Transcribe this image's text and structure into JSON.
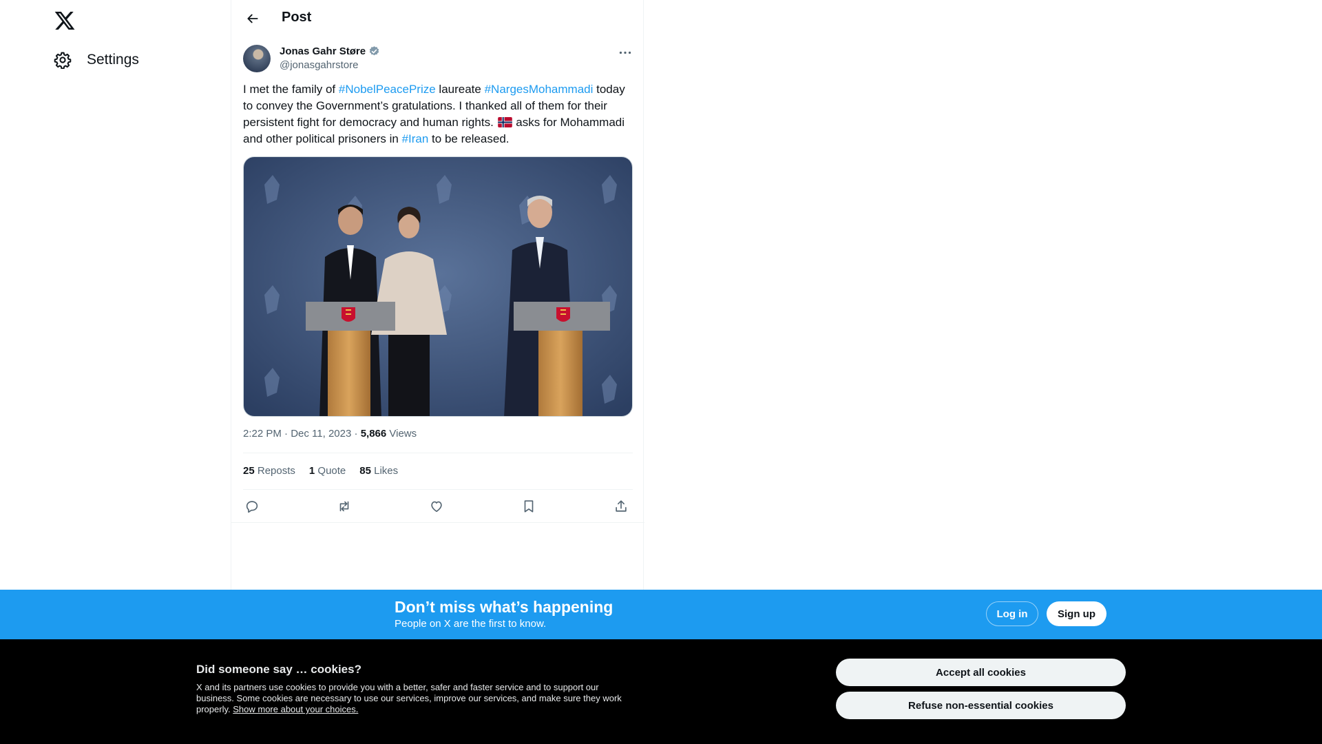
{
  "sidebar": {
    "logo_icon": "x-logo-icon",
    "settings_label": "Settings",
    "settings_icon": "gear-icon"
  },
  "header": {
    "title": "Post",
    "back_icon": "arrow-left-icon"
  },
  "post": {
    "author_name": "Jonas Gahr Støre",
    "author_handle": "@jonasgahrstore",
    "verified_icon": "verified-badge-icon",
    "more_icon": "more-dots-icon",
    "text": {
      "t1": "I met the family of ",
      "h1": "#NobelPeacePrize",
      "t2": " laureate ",
      "h2": "#NargesMohammadi",
      "t3": " today to convey the Government’s gratulations. I thanked all of them for their persistent fight for democracy and human rights. ",
      "flag": "norway-flag-emoji",
      "t4": " asks for Mohammadi and other political prisoners in ",
      "h3": "#Iran",
      "t5": " to be released."
    },
    "meta": {
      "time": "2:22 PM",
      "sep1": " · ",
      "date": "Dec 11, 2023",
      "sep2": " · ",
      "views_count": "5,866",
      "views_label": " Views"
    },
    "stats": {
      "reposts_count": "25",
      "reposts_label": " Reposts",
      "quotes_count": "1",
      "quotes_label": " Quote",
      "likes_count": "85",
      "likes_label": " Likes"
    },
    "actions": [
      "reply-icon",
      "repost-icon",
      "like-icon",
      "bookmark-icon",
      "share-icon"
    ]
  },
  "banner": {
    "title": "Don’t miss what’s happening",
    "subtitle": "People on X are the first to know.",
    "login_label": "Log in",
    "signup_label": "Sign up"
  },
  "cookies": {
    "title": "Did someone say … cookies?",
    "body": "X and its partners use cookies to provide you with a better, safer and faster service and to support our business. Some cookies are necessary to use our services, improve our services, and make sure they work properly. ",
    "link": "Show more about your choices.",
    "accept_label": "Accept all cookies",
    "refuse_label": "Refuse non-essential cookies"
  },
  "colors": {
    "accent": "#1d9bf0",
    "text_primary": "#0f1419",
    "text_secondary": "#536471",
    "cookie_bg": "#000000"
  }
}
